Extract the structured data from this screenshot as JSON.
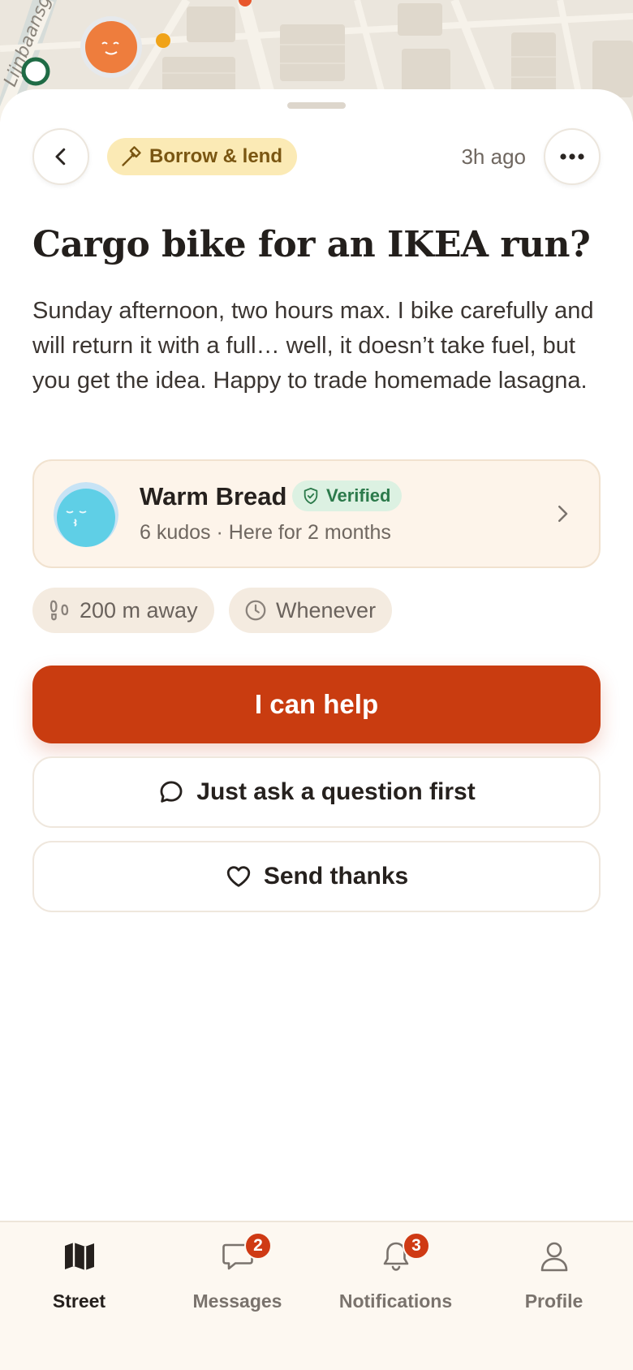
{
  "map": {
    "street_label": "Lijnbaansgr",
    "colors": {
      "map_bg": "#ebe6dd",
      "road": "#f6f2ea",
      "block": "#dfd8cc"
    }
  },
  "header": {
    "back_icon": "chevron-left-icon",
    "category": {
      "icon": "hammer-icon",
      "label": "Borrow & lend"
    },
    "time_ago": "3h ago",
    "more_icon": "more-horizontal-icon"
  },
  "post": {
    "title": "Cargo bike for an IKEA run?",
    "description": "Sunday afternoon, two hours max. I bike carefully and will return it with a full… well, it doesn’t take fuel, but you get the idea. Happy to trade homemade lasagna."
  },
  "author": {
    "name": "Warm Bread",
    "verified_label": "Verified",
    "kudos": "6 kudos",
    "separator": "·",
    "member_since": "Here for 2 months"
  },
  "chips": {
    "distance": {
      "icon": "footprints-icon",
      "label": "200 m away"
    },
    "timing": {
      "icon": "clock-icon",
      "label": "Whenever"
    }
  },
  "actions": {
    "primary": "I can help",
    "ask": {
      "icon": "chat-bubble-icon",
      "label": "Just ask a question first"
    },
    "thanks": {
      "icon": "heart-icon",
      "label": "Send thanks"
    }
  },
  "tabbar": {
    "tabs": [
      {
        "label": "Street",
        "icon": "map-icon",
        "active": true
      },
      {
        "label": "Messages",
        "icon": "message-icon",
        "badge": "2"
      },
      {
        "label": "Notifications",
        "icon": "bell-icon",
        "badge": "3"
      },
      {
        "label": "Profile",
        "icon": "user-icon"
      }
    ]
  },
  "colors": {
    "accent": "#c93c10",
    "category_bg": "#fbeab5",
    "verified_bg": "#dcf1e2",
    "card_bg": "#fdf4ea",
    "badge": "#cf3a14"
  }
}
